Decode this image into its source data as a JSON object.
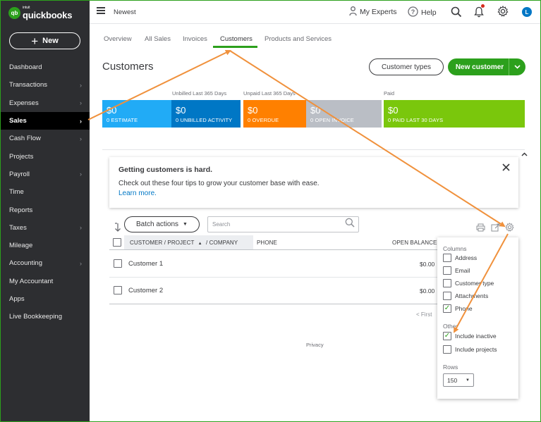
{
  "brand": {
    "badge": "qb",
    "small": "intuit",
    "name": "quickbooks"
  },
  "sidebar": {
    "new_label": "New",
    "items": [
      {
        "label": "Dashboard",
        "chevron": false,
        "active": false
      },
      {
        "label": "Transactions",
        "chevron": true,
        "active": false
      },
      {
        "label": "Expenses",
        "chevron": true,
        "active": false
      },
      {
        "label": "Sales",
        "chevron": true,
        "active": true
      },
      {
        "label": "Cash Flow",
        "chevron": true,
        "active": false
      },
      {
        "label": "Projects",
        "chevron": false,
        "active": false
      },
      {
        "label": "Payroll",
        "chevron": true,
        "active": false
      },
      {
        "label": "Time",
        "chevron": false,
        "active": false
      },
      {
        "label": "Reports",
        "chevron": false,
        "active": false
      },
      {
        "label": "Taxes",
        "chevron": true,
        "active": false
      },
      {
        "label": "Mileage",
        "chevron": false,
        "active": false
      },
      {
        "label": "Accounting",
        "chevron": true,
        "active": false
      },
      {
        "label": "My Accountant",
        "chevron": false,
        "active": false
      },
      {
        "label": "Apps",
        "chevron": false,
        "active": false
      },
      {
        "label": "Live Bookkeeping",
        "chevron": false,
        "active": false
      }
    ]
  },
  "header": {
    "company": "Newest",
    "my_experts": "My Experts",
    "help": "Help",
    "avatar": "L"
  },
  "tabs": [
    {
      "label": "Overview"
    },
    {
      "label": "All Sales"
    },
    {
      "label": "Invoices"
    },
    {
      "label": "Customers",
      "active": true
    },
    {
      "label": "Products and Services"
    }
  ],
  "page": {
    "title": "Customers",
    "customer_types_label": "Customer types",
    "new_customer_label": "New customer"
  },
  "metrics": {
    "captions": {
      "unbilled": "Unbilled Last 365 Days",
      "unpaid": "Unpaid Last 365 Days",
      "paid": "Paid"
    },
    "tiles": [
      {
        "amount": "$0",
        "label": "0 ESTIMATE",
        "color": "#21abf6"
      },
      {
        "amount": "$0",
        "label": "0 UNBILLED ACTIVITY",
        "color": "#0077c5"
      },
      {
        "amount": "$0",
        "label": "0 OVERDUE",
        "color": "#ff8000"
      },
      {
        "amount": "$0",
        "label": "0 OPEN INVOICE",
        "color": "#babec5"
      },
      {
        "amount": "$0",
        "label": "0 PAID LAST 30 DAYS",
        "color": "#7ac70c"
      }
    ]
  },
  "tip": {
    "title": "Getting customers is hard.",
    "body": "Check out these four tips to grow your customer base with ease.",
    "link": "Learn more."
  },
  "toolbar": {
    "batch_label": "Batch actions",
    "search_placeholder": "Search"
  },
  "table": {
    "headers": {
      "customer": "CUSTOMER / PROJECT",
      "company": "/ COMPANY",
      "phone": "PHONE",
      "balance": "OPEN BALANCE"
    },
    "rows": [
      {
        "name": "Customer 1",
        "balance": "$0.00"
      },
      {
        "name": "Customer 2",
        "balance": "$0.00"
      }
    ],
    "pager": "< First"
  },
  "footer": {
    "privacy": "Privacy"
  },
  "settings": {
    "columns_label": "Columns",
    "columns": [
      {
        "label": "Address",
        "checked": false
      },
      {
        "label": "Email",
        "checked": false
      },
      {
        "label": "Customer type",
        "checked": false
      },
      {
        "label": "Attachments",
        "checked": false
      },
      {
        "label": "Phone",
        "checked": true
      }
    ],
    "other_label": "Other",
    "other": [
      {
        "label": "Include inactive",
        "checked": true
      },
      {
        "label": "Include projects",
        "checked": false
      }
    ],
    "rows_label": "Rows",
    "rows_value": "150"
  },
  "colors": {
    "accent": "#2ca01c",
    "annotation": "#f0913c",
    "sidebar": "#2d2e31"
  }
}
